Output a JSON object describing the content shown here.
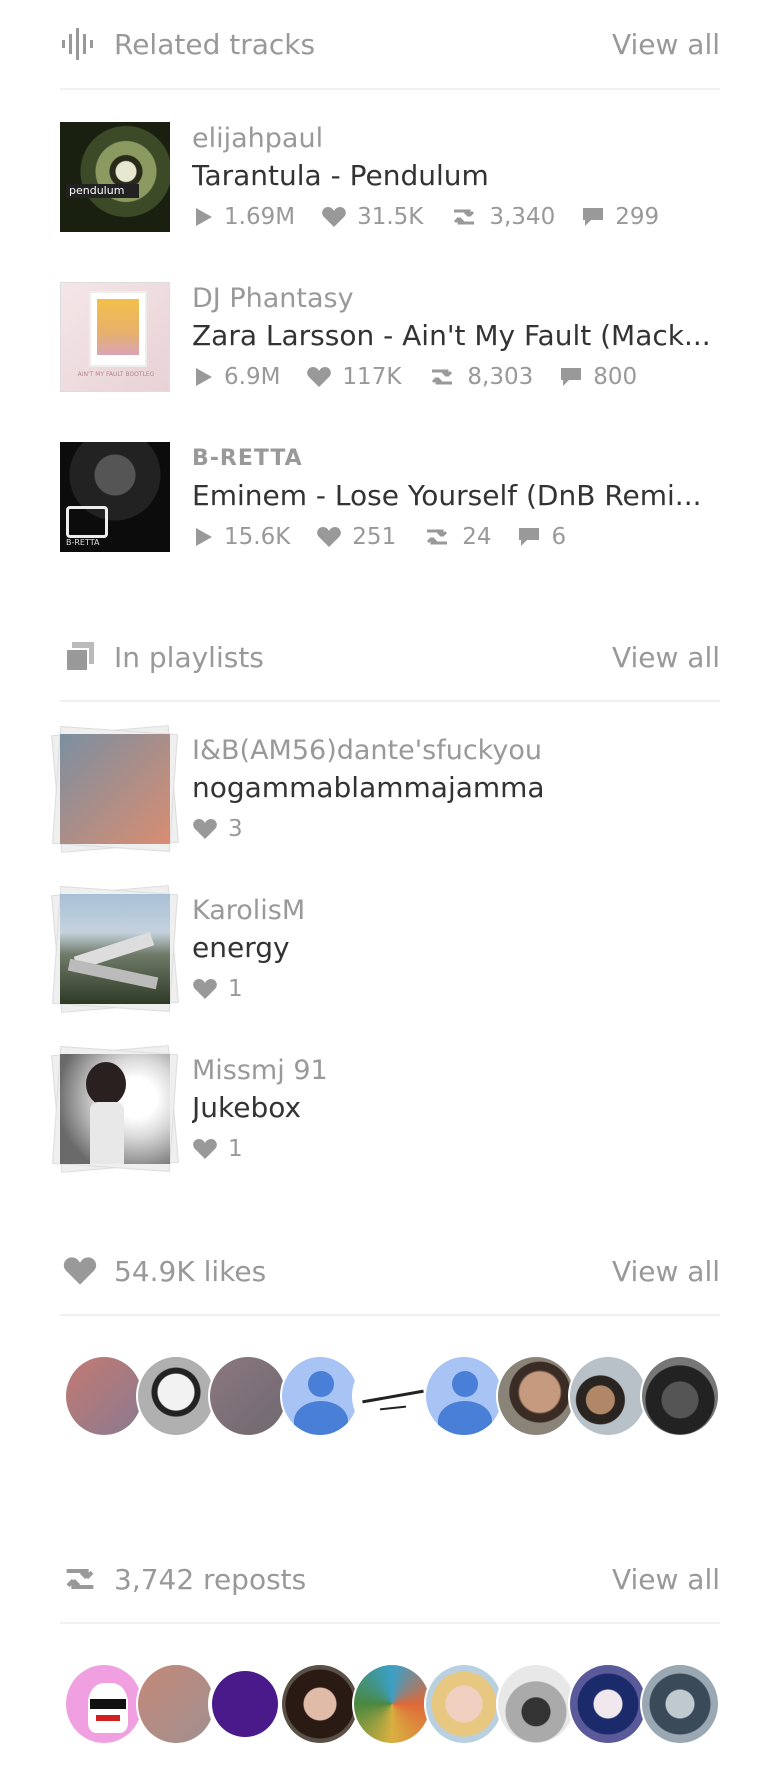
{
  "related": {
    "title": "Related tracks",
    "view_all": "View all",
    "tracks": [
      {
        "user": "elijahpaul",
        "title": "Tarantula - Pendulum",
        "plays": "1.69M",
        "likes": "31.5K",
        "reposts": "3,340",
        "comments": "299",
        "art_label": "pendulum"
      },
      {
        "user": "DJ Phantasy",
        "title": "Zara Larsson - Ain't My Fault (Mack...",
        "plays": "6.9M",
        "likes": "117K",
        "reposts": "8,303",
        "comments": "800",
        "art_label": "AIN'T MY FAULT BOOTLEG"
      },
      {
        "user": "B-RETTA",
        "title": "Eminem - Lose Yourself (DnB Remi...",
        "plays": "15.6K",
        "likes": "251",
        "reposts": "24",
        "comments": "6",
        "art_label": "B-RETTA"
      }
    ]
  },
  "playlists": {
    "title": "In playlists",
    "view_all": "View all",
    "items": [
      {
        "user": "I&B(AM56)dante'sfuckyou",
        "title": "nogammablammajamma",
        "likes": "3"
      },
      {
        "user": "KarolisM",
        "title": "energy",
        "likes": "1"
      },
      {
        "user": "Missmj 91",
        "title": "Jukebox",
        "likes": "1"
      }
    ]
  },
  "likes": {
    "title": "54.9K likes",
    "view_all": "View all"
  },
  "reposts": {
    "title": "3,742 reposts",
    "view_all": "View all"
  },
  "colors": {
    "accent": "#999999",
    "text": "#333333",
    "divider": "#f0f0f0"
  }
}
